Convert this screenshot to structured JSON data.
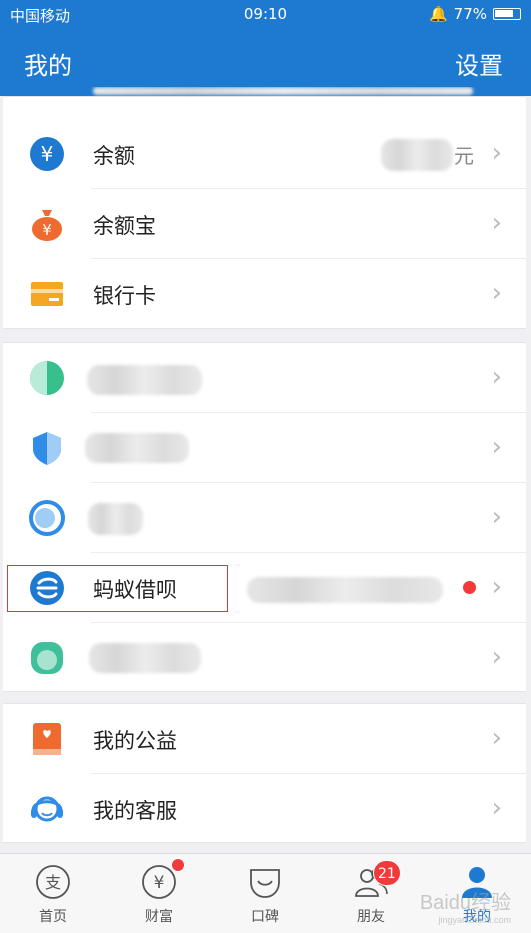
{
  "status_bar": {
    "carrier": "中国移动",
    "time": "09:10",
    "battery": "77%"
  },
  "header": {
    "title": "我的",
    "settings_label": "设置"
  },
  "group1": {
    "rows": [
      {
        "label": "余额",
        "suffix": "元"
      },
      {
        "label": "余额宝"
      },
      {
        "label": "银行卡"
      }
    ]
  },
  "group2": {
    "highlight_row": {
      "label": "蚂蚁借呗"
    }
  },
  "group3": {
    "rows": [
      {
        "label": "我的公益"
      },
      {
        "label": "我的客服"
      }
    ]
  },
  "tabbar": {
    "tabs": [
      {
        "label": "首页"
      },
      {
        "label": "财富"
      },
      {
        "label": "口碑"
      },
      {
        "label": "朋友",
        "badge": "21"
      },
      {
        "label": "我的"
      }
    ]
  },
  "watermark": {
    "text": "Baidu经验",
    "sub": "jingyan.baidu.com"
  },
  "colors": {
    "primary": "#1e7ad0",
    "badge": "#f23a3a",
    "highlight_border": "#d93a3a"
  }
}
